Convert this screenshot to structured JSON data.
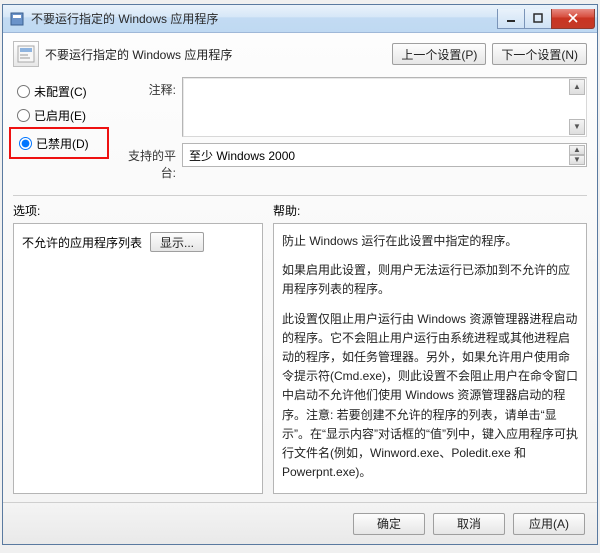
{
  "window": {
    "title": "不要运行指定的 Windows 应用程序"
  },
  "header": {
    "title": "不要运行指定的 Windows 应用程序",
    "prev": "上一个设置(P)",
    "next": "下一个设置(N)"
  },
  "radios": {
    "not_configured": "未配置(C)",
    "enabled": "已启用(E)",
    "disabled": "已禁用(D)",
    "selected": "disabled"
  },
  "fields": {
    "comment_label": "注释:",
    "platform_label": "支持的平台:",
    "platform_value": "至少 Windows 2000"
  },
  "mid": {
    "options_label": "选项:",
    "help_label": "帮助:"
  },
  "options": {
    "disallowed_label": "不允许的应用程序列表",
    "show_btn": "显示..."
  },
  "help": {
    "p1": "防止 Windows 运行在此设置中指定的程序。",
    "p2": "如果启用此设置，则用户无法运行已添加到不允许的应用程序列表的程序。",
    "p3": "此设置仅阻止用户运行由 Windows 资源管理器进程启动的程序。它不会阻止用户运行由系统进程或其他进程启动的程序，如任务管理器。另外，如果允许用户使用命令提示符(Cmd.exe)，则此设置不会阻止用户在命令窗口中启动不允许他们使用 Windows 资源管理器启动的程序。注意: 若要创建不允许的程序的列表，请单击“显示”。在“显示内容”对话框的“值”列中，键入应用程序可执行文件名(例如，Winword.exe、Poledit.exe 和 Powerpnt.exe)。"
  },
  "footer": {
    "ok": "确定",
    "cancel": "取消",
    "apply": "应用(A)"
  }
}
